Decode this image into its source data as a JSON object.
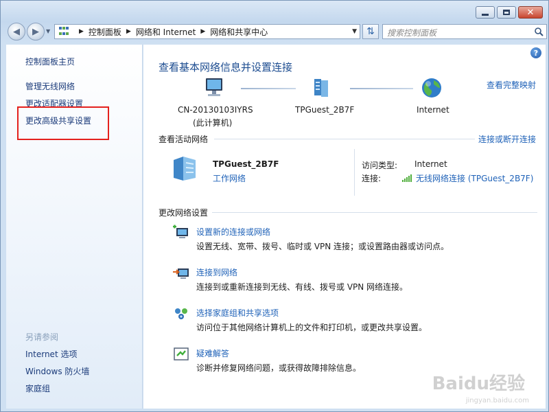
{
  "window": {
    "caption_buttons": {
      "minimize": "minimize-icon",
      "maximize": "maximize-icon",
      "close": "close-icon"
    }
  },
  "nav": {
    "back_icon": "back-arrow-icon",
    "forward_icon": "forward-arrow-icon",
    "breadcrumb": [
      "控制面板",
      "网络和 Internet",
      "网络和共享中心"
    ],
    "search_placeholder": "搜索控制面板",
    "refresh_icon": "refresh-icon",
    "search_icon": "search-icon"
  },
  "sidebar": {
    "home": "控制面板主页",
    "links": [
      "管理无线网络",
      "更改适配器设置",
      "更改高级共享设置"
    ],
    "see_also_heading": "另请参阅",
    "see_also": [
      "Internet 选项",
      "Windows 防火墙",
      "家庭组"
    ]
  },
  "main": {
    "title": "查看基本网络信息并设置连接",
    "full_map": "查看完整映射",
    "nodes": [
      {
        "label": "CN-20130103IYRS",
        "sub": "(此计算机)",
        "icon": "computer-icon"
      },
      {
        "label": "TPGuest_2B7F",
        "sub": "",
        "icon": "network-icon"
      },
      {
        "label": "Internet",
        "sub": "",
        "icon": "globe-icon"
      }
    ],
    "active_header": "查看活动网络",
    "connect_link": "连接或断开连接",
    "network": {
      "name": "TPGuest_2B7F",
      "type": "工作网络",
      "access_key": "访问类型:",
      "access_value": "Internet",
      "conn_key": "连接:",
      "conn_value": "无线网络连接 (TPGuest_2B7F)"
    },
    "change_header": "更改网络设置",
    "tasks": [
      {
        "link": "设置新的连接或网络",
        "desc": "设置无线、宽带、拨号、临时或 VPN 连接；或设置路由器或访问点。",
        "icon": "new-connection-icon"
      },
      {
        "link": "连接到网络",
        "desc": "连接到或重新连接到无线、有线、拨号或 VPN 网络连接。",
        "icon": "connect-network-icon"
      },
      {
        "link": "选择家庭组和共享选项",
        "desc": "访问位于其他网络计算机上的文件和打印机，或更改共享设置。",
        "icon": "homegroup-icon"
      },
      {
        "link": "疑难解答",
        "desc": "诊断并修复网络问题，或获得故障排除信息。",
        "icon": "troubleshoot-icon"
      }
    ]
  },
  "watermark": {
    "text": "Baidu经验",
    "sub": "jingyan.baidu.com"
  },
  "colors": {
    "link": "#1f62b8",
    "title": "#1c4c90",
    "highlight": "#e4201d"
  }
}
